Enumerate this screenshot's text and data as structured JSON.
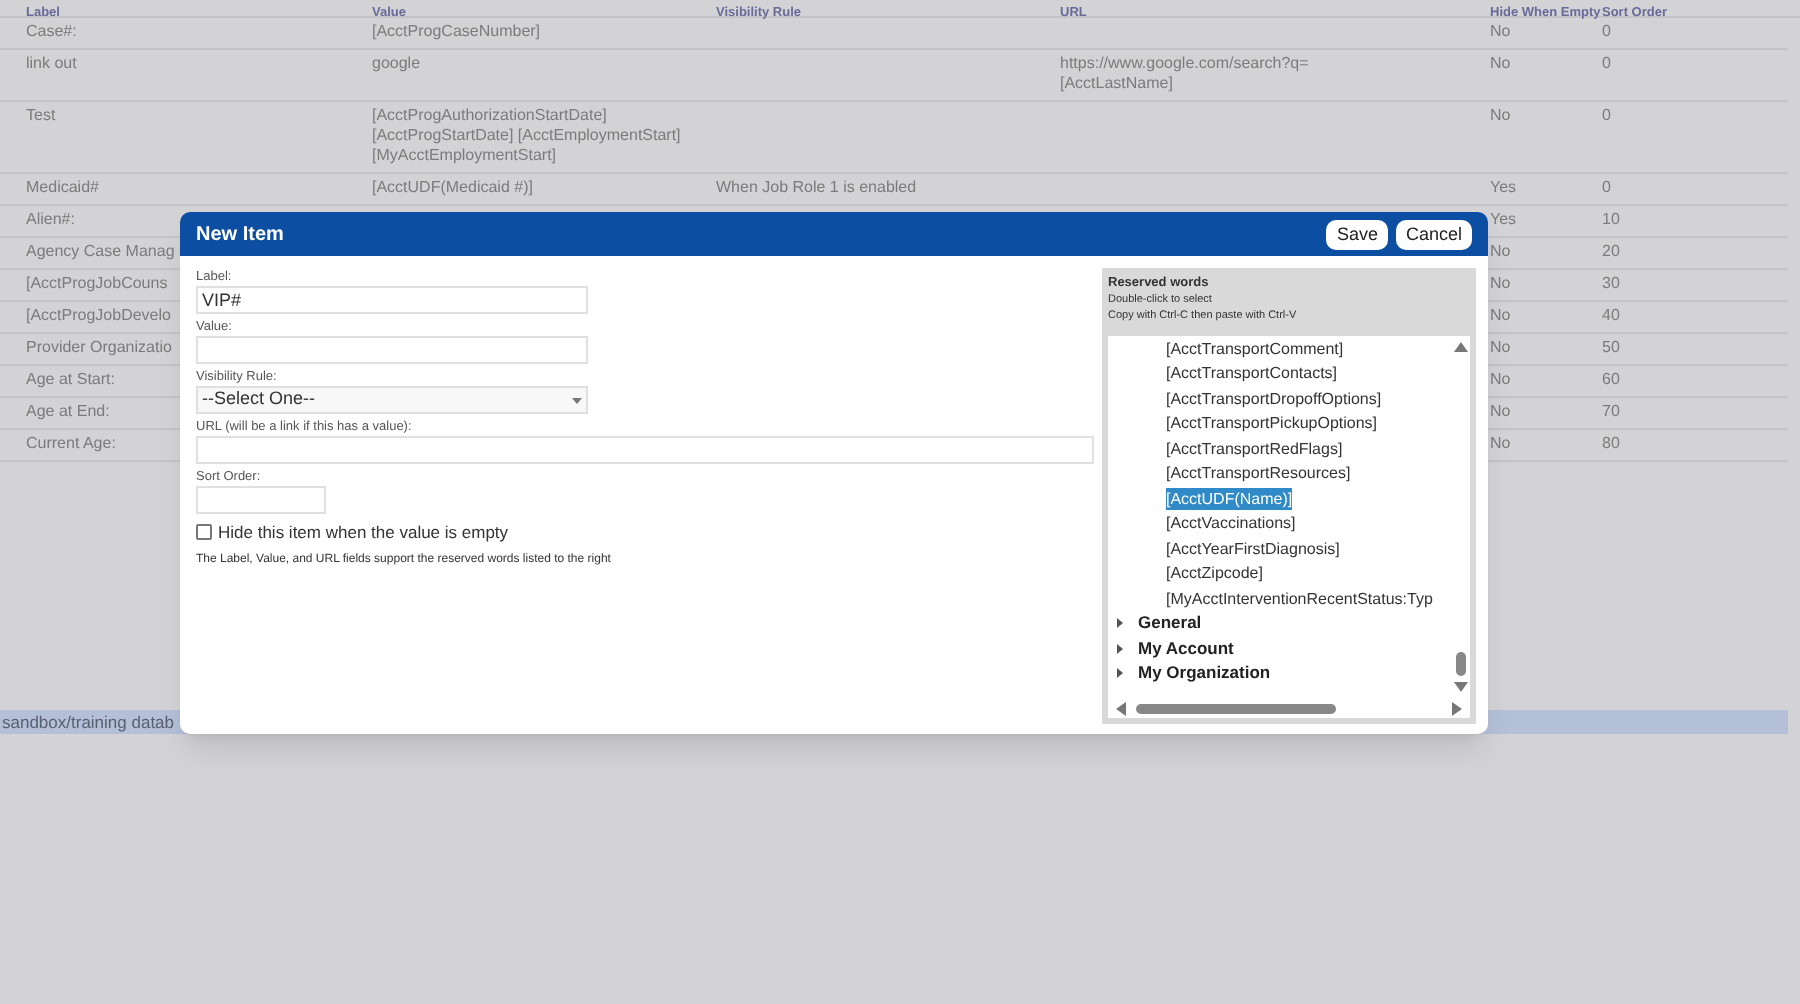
{
  "table": {
    "columns": [
      "Label",
      "Value",
      "Visibility Rule",
      "URL",
      "Hide When Empty",
      "Sort Order"
    ],
    "rows": [
      {
        "label": "Case#:",
        "value": [
          "[AcctProgCaseNumber]"
        ],
        "visibility_rule": "",
        "url": [],
        "hide_when_empty": "No",
        "sort_order": "0"
      },
      {
        "label": "link out",
        "value": [
          "google"
        ],
        "visibility_rule": "",
        "url": [
          "https://www.google.com/search?q=",
          "[AcctLastName]"
        ],
        "hide_when_empty": "No",
        "sort_order": "0"
      },
      {
        "label": "Test",
        "value": [
          "[AcctProgAuthorizationStartDate]",
          "[AcctProgStartDate] [AcctEmploymentStart]",
          "[MyAcctEmploymentStart]"
        ],
        "visibility_rule": "",
        "url": [],
        "hide_when_empty": "No",
        "sort_order": "0"
      },
      {
        "label": "Medicaid#",
        "value": [
          "[AcctUDF(Medicaid #)]"
        ],
        "visibility_rule": "When Job Role 1 is enabled",
        "url": [],
        "hide_when_empty": "Yes",
        "sort_order": "0"
      },
      {
        "label": "Alien#:",
        "value": [],
        "visibility_rule": "",
        "url": [],
        "hide_when_empty": "Yes",
        "sort_order": "10"
      },
      {
        "label": "Agency Case Manag",
        "value": [],
        "visibility_rule": "",
        "url": [],
        "hide_when_empty": "No",
        "sort_order": "20"
      },
      {
        "label": "[AcctProgJobCouns",
        "value": [],
        "visibility_rule": "",
        "url": [],
        "hide_when_empty": "No",
        "sort_order": "30"
      },
      {
        "label": "[AcctProgJobDevelo",
        "value": [],
        "visibility_rule": "",
        "url": [],
        "hide_when_empty": "No",
        "sort_order": "40"
      },
      {
        "label": "Provider Organizatio",
        "value": [],
        "visibility_rule": "",
        "url": [],
        "hide_when_empty": "No",
        "sort_order": "50"
      },
      {
        "label": "Age at Start:",
        "value": [],
        "visibility_rule": "",
        "url": [],
        "hide_when_empty": "No",
        "sort_order": "60"
      },
      {
        "label": "Age at End:",
        "value": [],
        "visibility_rule": "",
        "url": [],
        "hide_when_empty": "No",
        "sort_order": "70"
      },
      {
        "label": "Current Age:",
        "value": [],
        "visibility_rule": "",
        "url": [],
        "hide_when_empty": "No",
        "sort_order": "80"
      }
    ]
  },
  "status_bar": {
    "text": "sandbox/training datab"
  },
  "dialog": {
    "title": "New Item",
    "buttons": [
      "Save",
      "Cancel"
    ],
    "fields": [
      {
        "kind": "text",
        "label": "Label:",
        "value": "VIP#"
      },
      {
        "kind": "text",
        "label": "Value:"
      },
      {
        "kind": "select",
        "label": "Visibility Rule:",
        "value": "--Select One--"
      },
      {
        "kind": "wide",
        "label": "URL (will be a link if this has a value):"
      },
      {
        "kind": "short",
        "label": "Sort Order:"
      }
    ],
    "checkbox": {
      "label": "Hide this item when the value is empty",
      "checked": false
    },
    "note": "The Label, Value, and URL fields support the reserved words listed to the right",
    "reserved": {
      "title": "Reserved words",
      "hints": [
        "Double-click to select",
        "Copy with Ctrl-C then paste with Ctrl-V"
      ],
      "words": [
        {
          "text": "[AcctTransportComment]",
          "selected": false
        },
        {
          "text": "[AcctTransportContacts]",
          "selected": false
        },
        {
          "text": "[AcctTransportDropoffOptions]",
          "selected": false
        },
        {
          "text": "[AcctTransportPickupOptions]",
          "selected": false
        },
        {
          "text": "[AcctTransportRedFlags]",
          "selected": false
        },
        {
          "text": "[AcctTransportResources]",
          "selected": false
        },
        {
          "text": "[AcctUDF(Name)]",
          "selected": true
        },
        {
          "text": "[AcctVaccinations]",
          "selected": false
        },
        {
          "text": "[AcctYearFirstDiagnosis]",
          "selected": false
        },
        {
          "text": "[AcctZipcode]",
          "selected": false
        },
        {
          "text": "[MyAcctInterventionRecentStatus:Typ",
          "selected": false
        }
      ],
      "groups": [
        {
          "label": "General",
          "expanded": false
        },
        {
          "label": "My Account",
          "expanded": false
        },
        {
          "label": "My Organization",
          "expanded": false
        }
      ]
    }
  }
}
